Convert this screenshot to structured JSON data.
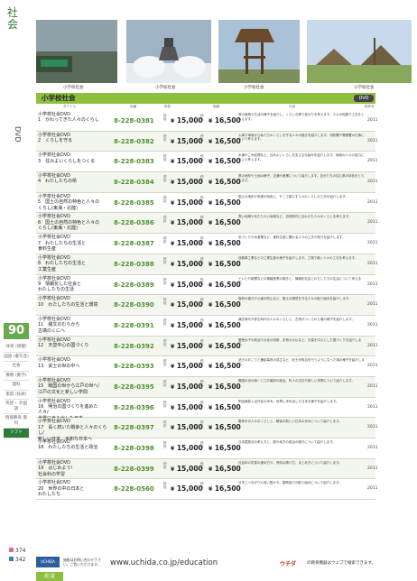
{
  "sidebar": {
    "title": "社会",
    "category": "DVD",
    "page_number": "90",
    "nav": [
      "体育\n(保健)",
      "国語\n(書写含)",
      "社会",
      "算数\n(数学)",
      "理科",
      "家庭\n(技術)",
      "英語・\n外国語",
      "情報教育\n資料",
      "ソフト"
    ],
    "active_nav": "ソフト",
    "marks": [
      "374",
      "342"
    ]
  },
  "photos": {
    "captions": [
      "小学校社会",
      "小学校社会",
      "小学校社会",
      "小学校社会"
    ]
  },
  "section": {
    "title": "小学校社会",
    "badge": "DVD"
  },
  "table_header": {
    "col_title": "タイトル",
    "col_code": "品番",
    "col_price_tax": "税抜",
    "col_price": "価格",
    "col_desc": "内容",
    "col_year": "制作年"
  },
  "rows": [
    {
      "t1": "小学校社会DVD",
      "t2": "1　かわってきた人々のくらし",
      "t3": "",
      "code": "8-228-0381",
      "p1": "15,000",
      "p2": "16,500",
      "desc": "昔の道具や生活の様子を紹介し、くらしの移り変わりを考えます。人々の知恵や工夫をとらえます。",
      "year": "2011"
    },
    {
      "t1": "小学校社会DVD",
      "t2": "2　くらしを守る",
      "t3": "",
      "code": "8-228-0382",
      "p1": "15,000",
      "p2": "16,500",
      "desc": "火事や事故から私たちのくらしを守る人々の働きを紹介します。消防署や警察署の仕事について考えます。",
      "year": "2011"
    },
    {
      "t1": "小学校社会DVD",
      "t2": "3　住みよいくらしをつくる",
      "t3": "",
      "code": "8-228-0383",
      "p1": "15,000",
      "p2": "16,500",
      "desc": "水道やごみ処理など、住みよいくらしを支える仕組みを紹介します。地域の人々の協力について考えます。",
      "year": "2011"
    },
    {
      "t1": "小学校社会DVD",
      "t2": "4　わたしたちの県",
      "t3": "",
      "code": "8-228-0384",
      "p1": "15,000",
      "p2": "16,500",
      "desc": "県の地形や土地の様子、交通や産業について紹介します。自分たちの住む県の特色をとらえます。",
      "year": "2011"
    },
    {
      "t1": "小学校社会DVD",
      "t2": "5　国土の自然の特色と人々の",
      "t3": "くらし(東海・北陸)",
      "code": "8-228-0385",
      "p1": "15,000",
      "p2": "16,500",
      "desc": "国土の地形や気候の特色と、そこで暮らす人々のくらしの工夫を紹介します。",
      "year": "2011"
    },
    {
      "t1": "小学校社会DVD",
      "t2": "6　国土の自然の特色と人々の",
      "t3": "くらし(東海・北陸)",
      "code": "8-228-0386",
      "p1": "15,000",
      "p2": "16,500",
      "desc": "寒い地域やあたたかい地域など、自然条件に合わせた人々のくらしを考えます。",
      "year": "2011"
    },
    {
      "t1": "小学校社会DVD",
      "t2": "7　わたしたちの生活と",
      "t3": "食料生産",
      "code": "8-228-0387",
      "p1": "15,000",
      "p2": "16,500",
      "desc": "米づくりや水産業など、食料生産に関わる人々の工夫や努力を紹介します。",
      "year": "2011"
    },
    {
      "t1": "小学校社会DVD",
      "t2": "8　わたしたちの生活と",
      "t3": "工業生産",
      "code": "8-228-0388",
      "p1": "15,000",
      "p2": "16,500",
      "desc": "自動車工業などの工業生産の様子を紹介します。工場で働く人々の工夫を考えます。",
      "year": "2011"
    },
    {
      "t1": "小学校社会DVD",
      "t2": "9　情報化した社会と",
      "t3": "わたしたちの生活",
      "code": "8-228-0389",
      "p1": "15,000",
      "p2": "16,500",
      "desc": "テレビや新聞などの情報産業の働きと、情報化社会とわたしたちの生活について考えます。",
      "year": "2011"
    },
    {
      "t1": "小学校社会DVD",
      "t2": "10　わたしたちの生活と環境",
      "t3": "",
      "code": "8-228-0390",
      "p1": "15,000",
      "p2": "16,500",
      "desc": "森林の働きや公害の防止など、国土の環境を守る人々の取り組みを紹介します。",
      "year": "2011"
    },
    {
      "t1": "小学校社会DVD",
      "t2": "11　縄文のむらから",
      "t3": "古墳のくにへ",
      "code": "8-228-0391",
      "p1": "15,000",
      "p2": "16,500",
      "desc": "縄文時代や弥生時代の人々のくらしと、古墳がつくられた頃の様子を紹介します。",
      "year": "2011"
    },
    {
      "t1": "小学校社会DVD",
      "t2": "12　天皇中心の国づくり",
      "t3": "",
      "code": "8-228-0392",
      "p1": "15,000",
      "p2": "16,500",
      "desc": "聖徳太子の政治や大化の改新、奈良の大仏など、天皇を中心とした国づくりを紹介します。",
      "year": "2011"
    },
    {
      "t1": "小学校社会DVD",
      "t2": "13　武士の世の中へ",
      "t3": "",
      "code": "8-228-0393",
      "p1": "15,000",
      "p2": "16,500",
      "desc": "武士のおこりと鎌倉幕府の成立など、武士が政治を行うようになった頃の様子を紹介します。",
      "year": "2011"
    },
    {
      "t1": "小学校社会DVD",
      "t2": "15　戦国の世から江戸の世へ/",
      "t3": "江戸の文化と新しい学問",
      "code": "8-228-0395",
      "p1": "15,000",
      "p2": "16,500",
      "desc": "戦国の世の統一と江戸幕府の政治、町人の文化や新しい学問について紹介します。",
      "year": "2011"
    },
    {
      "t1": "小学校社会DVD",
      "t2": "16　明治の国づくりを進めた人々/",
      "t3": "世界に歩み出した日本",
      "code": "8-228-0396",
      "p1": "15,000",
      "p2": "16,500",
      "desc": "明治維新と近代化の歩み、世界に歩み出した日本の様子を紹介します。",
      "year": "2011"
    },
    {
      "t1": "小学校社会DVD",
      "t2": "17　長く続いた戦争と人々のくらし/",
      "t3": "新しい日本、平和な日本へ",
      "code": "8-228-0397",
      "p1": "15,000",
      "p2": "16,500",
      "desc": "戦争中の人々のくらしと、戦後の新しい日本の歩みについて紹介します。",
      "year": "2011"
    },
    {
      "t1": "小学校社会DVD",
      "t2": "18　わたしたちの生活と政治",
      "t3": "",
      "code": "8-228-0398",
      "p1": "15,000",
      "p2": "16,500",
      "desc": "日本国憲法の考え方と、国や地方の政治の働きについて紹介します。",
      "year": "2011"
    },
    {
      "t1": "小学校社会DVD",
      "t2": "19　はじめよう!",
      "t3": "社会科の学習",
      "code": "8-228-0399",
      "p1": "15,000",
      "p2": "16,500",
      "desc": "社会科の学習の進め方や、資料の調べ方、まとめ方について紹介します。",
      "year": "2011"
    },
    {
      "t1": "小学校社会DVD",
      "t2": "20　世界の中の日本と",
      "t3": "わたしたち",
      "code": "8-228-0560",
      "p1": "15,000",
      "p2": "16,500",
      "desc": "日本とつながりの深い国々や、国際協力の取り組みについて紹介します。",
      "year": "2011"
    }
  ],
  "footer": {
    "logo": "UCHIDA",
    "note": "価格はお問い合わせ下さい。ご覧いただけます。",
    "url": "www.uchida.co.jp/education",
    "brand": "ウチダ",
    "right": "の教育機器はウェブで検索できます。"
  },
  "bottom_tab": "総 説"
}
